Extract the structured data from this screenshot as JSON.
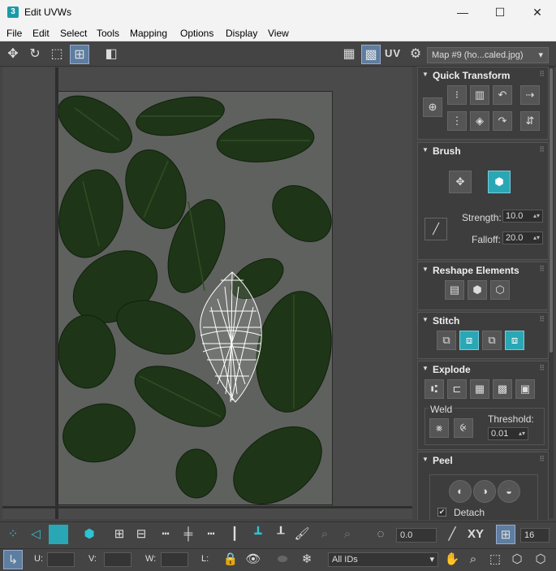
{
  "window": {
    "title": "Edit UVWs",
    "app_icon": "3",
    "controls": {
      "minimize": "—",
      "maximize": "☐",
      "close": "✕"
    }
  },
  "menu": [
    "File",
    "Edit",
    "Select",
    "Tools",
    "Mapping",
    "Options",
    "Display",
    "View"
  ],
  "toolbar": {
    "uv_label": "UV",
    "map_select": "Map #9 (ho...caled.jpg)"
  },
  "panel": {
    "quick_transform": {
      "title": "Quick Transform"
    },
    "brush": {
      "title": "Brush",
      "strength_label": "Strength:",
      "strength_value": "10.0",
      "falloff_label": "Falloff:",
      "falloff_value": "20.0"
    },
    "reshape": {
      "title": "Reshape Elements"
    },
    "stitch": {
      "title": "Stitch"
    },
    "explode": {
      "title": "Explode",
      "weld_label": "Weld",
      "threshold_label": "Threshold:",
      "threshold_value": "0.01"
    },
    "peel": {
      "title": "Peel",
      "detach_label": "Detach",
      "detach_checked": true
    }
  },
  "bottom": {
    "angle_value": "0.0",
    "xy_label": "XY",
    "snap_value": "16",
    "u_label": "U:",
    "v_label": "V:",
    "w_label": "W:",
    "l_label": "L:",
    "ids_select": "All IDs"
  },
  "colors": {
    "accent_teal": "#2aa7b5",
    "panel_bg": "#3d3d3d",
    "window_bg": "#444444"
  }
}
